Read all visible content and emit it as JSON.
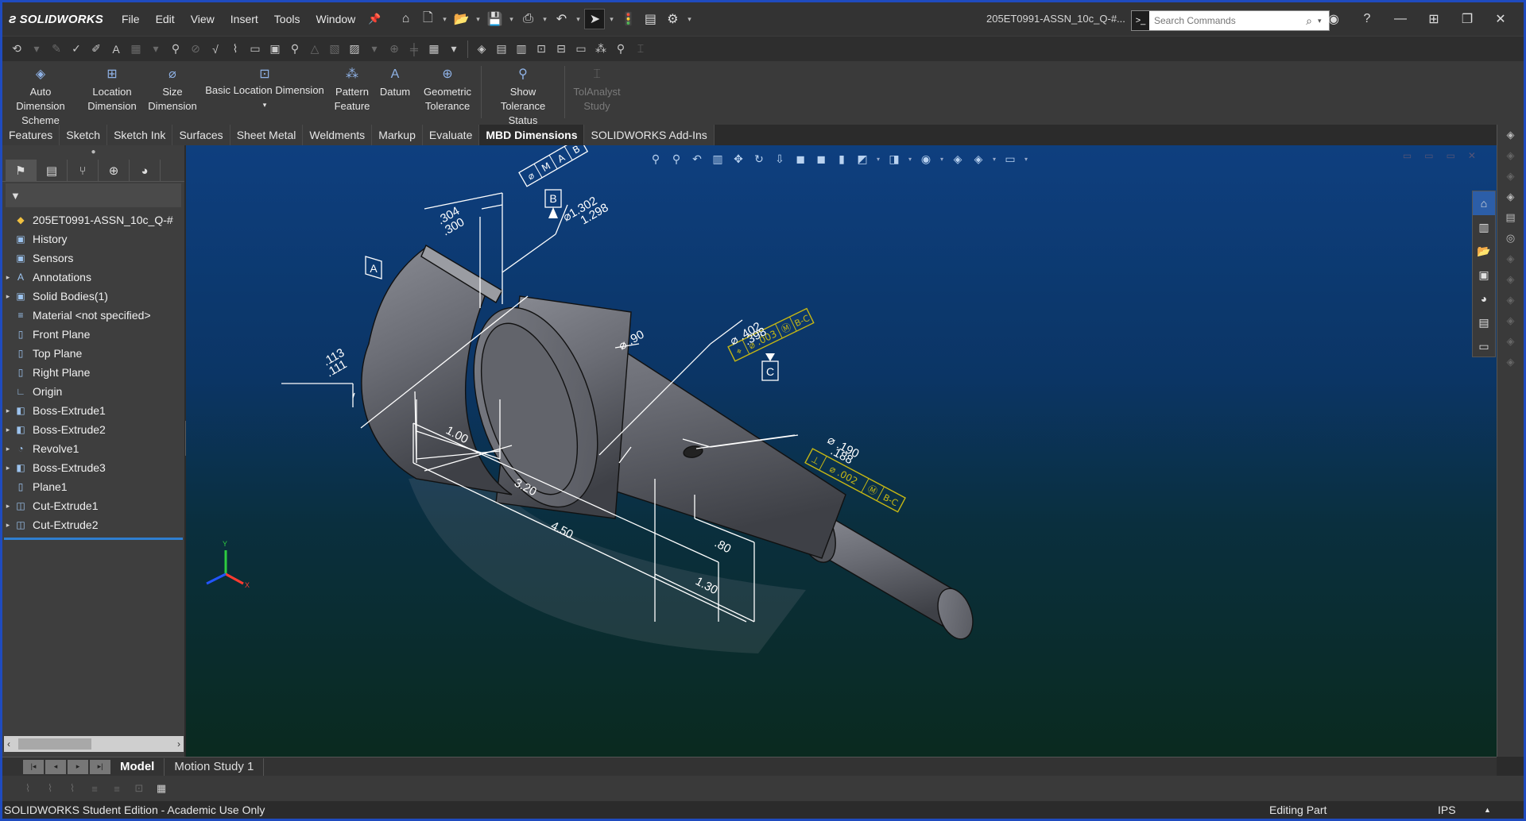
{
  "app": {
    "brand": "SOLIDWORKS",
    "document_title": "205ET0991-ASSN_10c_Q-#...",
    "menu": [
      "File",
      "Edit",
      "View",
      "Insert",
      "Tools",
      "Window"
    ],
    "search": {
      "placeholder": "Search Commands"
    }
  },
  "command_manager": {
    "commands": [
      {
        "line1": "Auto Dimension",
        "line2": "Scheme",
        "icon": "auto-dimension-icon",
        "enabled": true
      },
      {
        "line1": "Location",
        "line2": "Dimension",
        "icon": "location-dimension-icon",
        "enabled": true
      },
      {
        "line1": "Size",
        "line2": "Dimension",
        "icon": "size-dimension-icon",
        "enabled": true
      },
      {
        "line1": "Basic Location Dimension",
        "line2": "",
        "icon": "basic-location-dimension-icon",
        "enabled": true
      },
      {
        "line1": "Pattern",
        "line2": "Feature",
        "icon": "pattern-feature-icon",
        "enabled": true
      },
      {
        "line1": "Datum",
        "line2": "",
        "icon": "datum-icon",
        "enabled": true
      },
      {
        "line1": "Geometric",
        "line2": "Tolerance",
        "icon": "geometric-tolerance-icon",
        "enabled": true
      },
      {
        "line1": "Show Tolerance",
        "line2": "Status",
        "icon": "show-tolerance-status-icon",
        "enabled": true
      },
      {
        "line1": "TolAnalyst",
        "line2": "Study",
        "icon": "tolanalyst-study-icon",
        "enabled": false
      }
    ]
  },
  "tabs": [
    "Features",
    "Sketch",
    "Sketch Ink",
    "Surfaces",
    "Sheet Metal",
    "Weldments",
    "Markup",
    "Evaluate",
    "MBD Dimensions",
    "SOLIDWORKS Add-Ins"
  ],
  "active_tab": "MBD Dimensions",
  "feature_tree": {
    "root": "205ET0991-ASSN_10c_Q-#",
    "items": [
      {
        "label": "History",
        "expandable": false,
        "icon": "history-icon"
      },
      {
        "label": "Sensors",
        "expandable": false,
        "icon": "sensors-icon"
      },
      {
        "label": "Annotations",
        "expandable": true,
        "icon": "annotations-icon"
      },
      {
        "label": "Solid Bodies(1)",
        "expandable": true,
        "icon": "solid-bodies-icon"
      },
      {
        "label": "Material <not specified>",
        "expandable": false,
        "icon": "material-icon"
      },
      {
        "label": "Front Plane",
        "expandable": false,
        "icon": "plane-icon"
      },
      {
        "label": "Top Plane",
        "expandable": false,
        "icon": "plane-icon"
      },
      {
        "label": "Right Plane",
        "expandable": false,
        "icon": "plane-icon"
      },
      {
        "label": "Origin",
        "expandable": false,
        "icon": "origin-icon"
      },
      {
        "label": "Boss-Extrude1",
        "expandable": true,
        "icon": "extrude-icon"
      },
      {
        "label": "Boss-Extrude2",
        "expandable": true,
        "icon": "extrude-icon"
      },
      {
        "label": "Revolve1",
        "expandable": true,
        "icon": "revolve-icon"
      },
      {
        "label": "Boss-Extrude3",
        "expandable": true,
        "icon": "extrude-icon"
      },
      {
        "label": "Plane1",
        "expandable": false,
        "icon": "plane-icon"
      },
      {
        "label": "Cut-Extrude1",
        "expandable": true,
        "icon": "cut-extrude-icon"
      },
      {
        "label": "Cut-Extrude2",
        "expandable": true,
        "icon": "cut-extrude-icon"
      }
    ]
  },
  "annotations": {
    "dim_304_300": [
      ".304",
      ".300"
    ],
    "datum_B": "B",
    "dia_1302": [
      "⌀1.302",
      "1.298"
    ],
    "datum_A": "A",
    "dia_90": "⌀ .90",
    "dim_113_111": [
      ".113",
      ".111"
    ],
    "dim_100": "1.00",
    "dim_320": "3.20",
    "dim_450": "4.50",
    "dim_80": ".80",
    "dim_130": "1.30",
    "dia_402": [
      "⌀ .402",
      ".398"
    ],
    "fcf_top": [
      "⌀",
      "M",
      "A",
      "B"
    ],
    "fcf_yellow": [
      "⌖",
      "⌀ .003",
      "Ⓜ",
      "B-C"
    ],
    "datum_C": "C",
    "dia_190": [
      "⌀ .190",
      ".188"
    ],
    "fcf_bottom": [
      "⊥",
      "⌀ .002",
      "Ⓜ",
      "B-C"
    ],
    "axis_x": "X",
    "axis_y": "Y"
  },
  "colors": {
    "accent": "#2f7fd1",
    "viewport_top": "#0e3f7f",
    "viewport_bottom": "#0a2a1f",
    "part": "#6e7078",
    "annotation": "#ffffff",
    "fcf_yellow": "#c6b714"
  },
  "bottom_tabs": [
    "Model",
    "Motion Study 1"
  ],
  "status": {
    "edition": "SOLIDWORKS Student Edition - Academic Use Only",
    "mode": "Editing Part",
    "units": "IPS"
  }
}
